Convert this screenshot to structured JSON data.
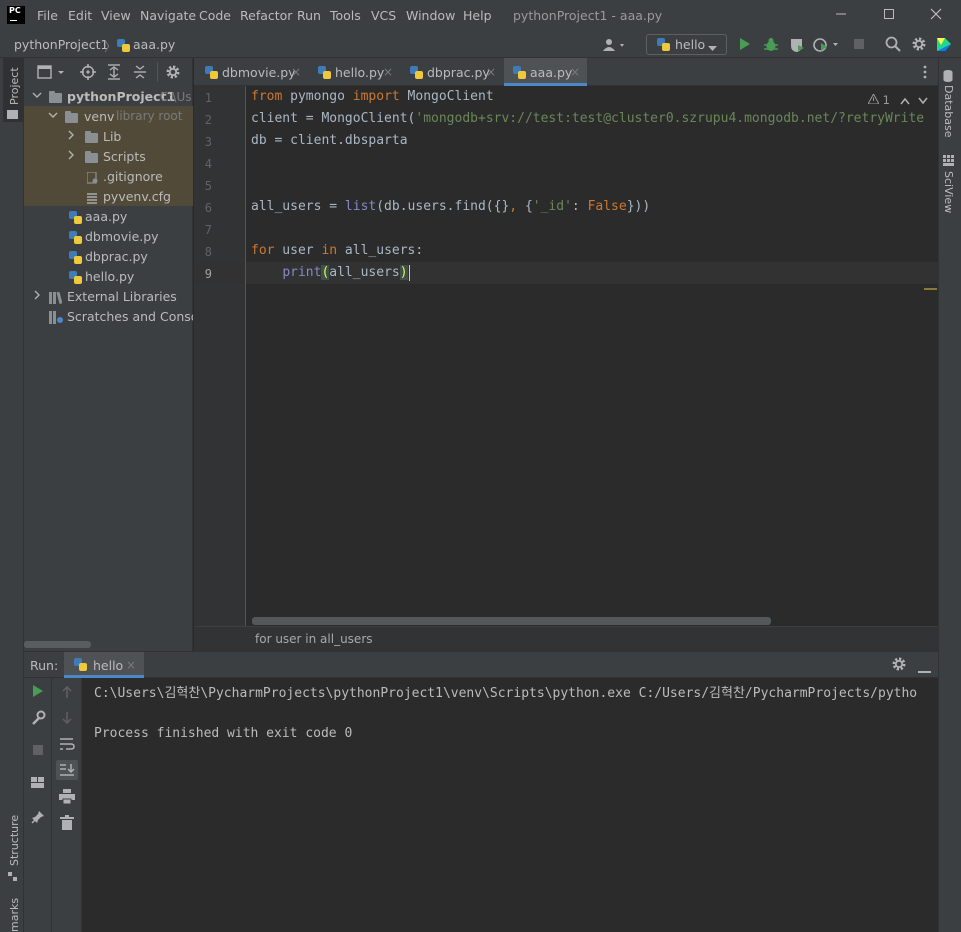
{
  "app": {
    "logo_text": "PC",
    "window_title": "pythonProject1 - aaa.py",
    "menu": [
      "File",
      "Edit",
      "View",
      "Navigate",
      "Code",
      "Refactor",
      "Run",
      "Tools",
      "VCS",
      "Window",
      "Help"
    ]
  },
  "navbar": {
    "project": "pythonProject1",
    "file": "aaa.py",
    "run_config": "hello"
  },
  "left_stripe": {
    "project": "Project",
    "structure": "Structure",
    "bookmarks": "marks"
  },
  "right_stripe": {
    "database": "Database",
    "sciview": "SciView"
  },
  "project_tree": {
    "root": {
      "label": "pythonProject1",
      "hint": "C:\\Us"
    },
    "venv": {
      "label": "venv",
      "hint": "library root"
    },
    "lib": "Lib",
    "scripts": "Scripts",
    "gitignore": ".gitignore",
    "pyvenv": "pyvenv.cfg",
    "files": [
      "aaa.py",
      "dbmovie.py",
      "dbprac.py",
      "hello.py"
    ],
    "external": "External Libraries",
    "scratches": "Scratches and Consoles"
  },
  "tabs": [
    {
      "label": "dbmovie.py",
      "close": "×"
    },
    {
      "label": "hello.py",
      "close": "×"
    },
    {
      "label": "dbprac.py",
      "close": "×"
    },
    {
      "label": "aaa.py",
      "close": "×"
    }
  ],
  "editor": {
    "line_numbers": [
      "1",
      "2",
      "3",
      "4",
      "5",
      "6",
      "7",
      "8",
      "9"
    ],
    "inspection_count": "1",
    "breadcrumb": "for user in all_users",
    "code": {
      "l1_from": "from",
      "l1_mod": " pymongo ",
      "l1_import": "import",
      "l1_cls": " MongoClient",
      "l2_a": "client = MongoClient(",
      "l2_str": "'mongodb+srv://test:test@cluster0.szrupu4.mongodb.net/?retryWrite",
      "l3": "db = client.dbsparta",
      "l6_a": "all_users = ",
      "l6_list": "list",
      "l6_b": "(db.users.find({}",
      "l6_comma": ",",
      "l6_c": " {",
      "l6_key": "'_id'",
      "l6_d": ": ",
      "l6_false": "False",
      "l6_e": "}))",
      "l8_for": "for",
      "l8_a": " user ",
      "l8_in": "in",
      "l8_b": " all_users:",
      "l9_indent": "    ",
      "l9_print": "print",
      "l9_open": "(",
      "l9_arg": "all_users",
      "l9_close": ")"
    }
  },
  "run": {
    "label": "Run:",
    "tab": "hello",
    "tab_close": "×",
    "console": [
      "C:\\Users\\김혁찬\\PycharmProjects\\pythonProject1\\venv\\Scripts\\python.exe C:/Users/김혁찬/PycharmProjects/pytho",
      "",
      "Process finished with exit code 0"
    ]
  },
  "colors": {
    "accent": "#4a88c7",
    "keyword": "#cc7832",
    "string": "#6a8759",
    "builtin": "#8888c6"
  }
}
